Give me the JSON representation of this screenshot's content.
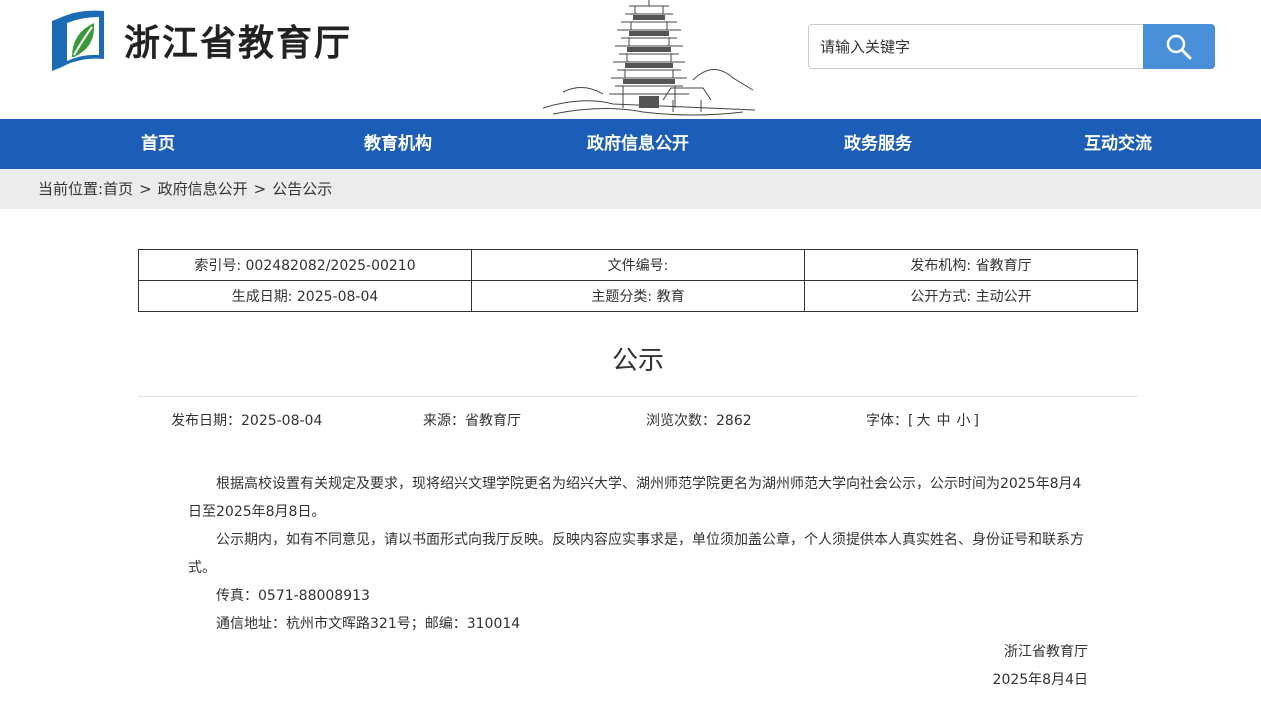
{
  "header": {
    "site_title": "浙江省教育厅",
    "logo_icon": "leaf-book-logo-icon",
    "banner_icon": "pagoda-illustration-icon",
    "search": {
      "placeholder": "请输入关键字",
      "button_icon": "search-icon"
    },
    "colors": {
      "logo_blue": "#1b6cb5",
      "logo_green": "#3a9a3a",
      "search_button": "#4a90d9"
    }
  },
  "nav": {
    "color": "#1b5db7",
    "items": [
      {
        "label": "首页"
      },
      {
        "label": "教育机构"
      },
      {
        "label": "政府信息公开"
      },
      {
        "label": "政务服务"
      },
      {
        "label": "互动交流"
      }
    ]
  },
  "breadcrumb": {
    "prefix": "当前位置:",
    "items": [
      "首页",
      "政府信息公开",
      "公告公示"
    ],
    "separator": ">"
  },
  "meta": {
    "rows": [
      [
        "索引号: 002482082/2025-00210",
        "文件编号:",
        "发布机构: 省教育厅"
      ],
      [
        "生成日期: 2025-08-04",
        "主题分类: 教育",
        "公开方式: 主动公开"
      ]
    ]
  },
  "article": {
    "title": "公示",
    "info": {
      "publish_date": "发布日期：2025-08-04",
      "source": "来源：省教育厅",
      "views": "浏览次数：2862",
      "font_label": "字体：[",
      "font_options": [
        "大",
        "中",
        "小"
      ],
      "font_close": "]"
    },
    "paragraphs": [
      "根据高校设置有关规定及要求，现将绍兴文理学院更名为绍兴大学、湖州师范学院更名为湖州师范大学向社会公示，公示时间为2025年8月4日至2025年8月8日。",
      "公示期内，如有不同意见，请以书面形式向我厅反映。反映内容应实事求是，单位须加盖公章，个人须提供本人真实姓名、身份证号和联系方式。",
      "传真：0571-88008913",
      "通信地址：杭州市文晖路321号；邮编：310014"
    ],
    "signature": {
      "org": "浙江省教育厅",
      "date": "2025年8月4日"
    }
  }
}
